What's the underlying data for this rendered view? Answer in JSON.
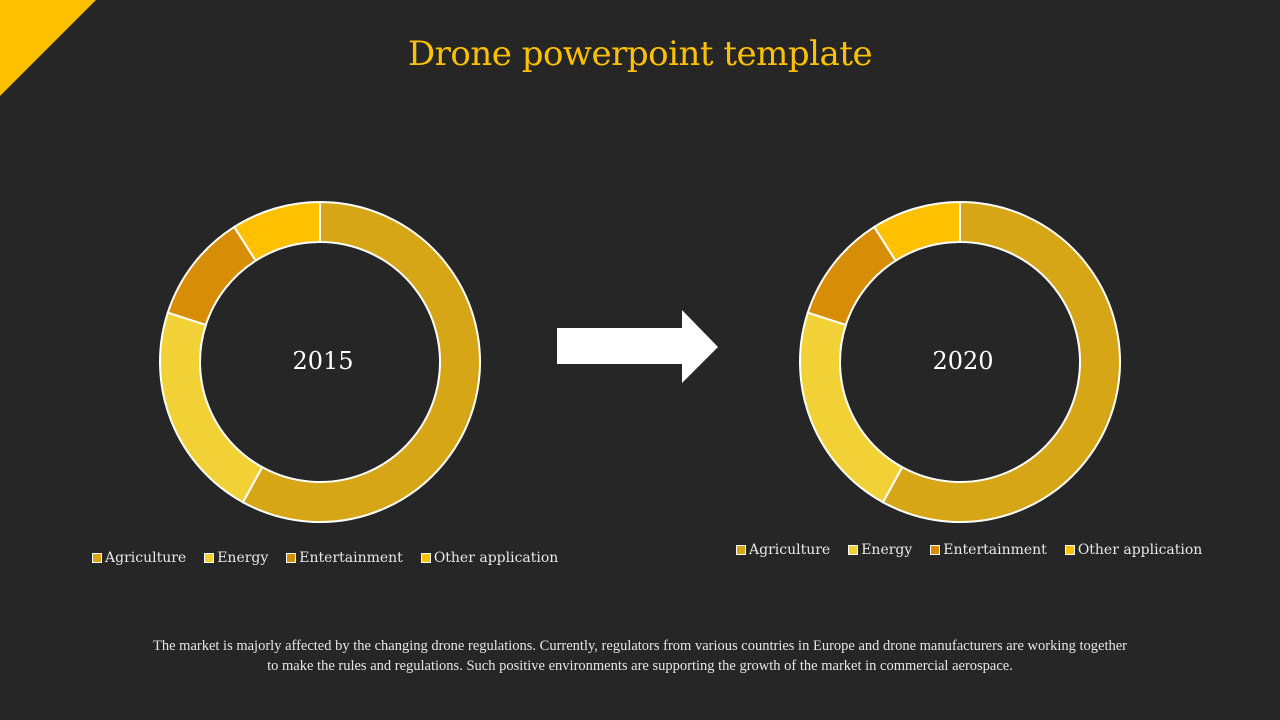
{
  "slide": {
    "title": "Drone powerpoint template",
    "accent_color": "#FFC000",
    "background_color": "#262626",
    "body_text": "The market is majorly affected by the changing drone regulations. Currently, regulators from various countries in Europe and drone manufacturers are working together to make the rules and regulations. Such positive environments are supporting the growth of the market in commercial aerospace.",
    "arrow_icon": "right-arrow"
  },
  "chart_data": [
    {
      "type": "pie",
      "variant": "donut",
      "title": "2015",
      "categories": [
        "Agriculture",
        "Energy",
        "Entertainment",
        "Other application"
      ],
      "values": [
        58,
        22,
        11,
        9
      ],
      "colors": [
        "#D6A617",
        "#F2D136",
        "#D78E06",
        "#FFC000"
      ],
      "legend_position": "bottom"
    },
    {
      "type": "pie",
      "variant": "donut",
      "title": "2020",
      "categories": [
        "Agriculture",
        "Energy",
        "Entertainment",
        "Other application"
      ],
      "values": [
        58,
        22,
        11,
        9
      ],
      "colors": [
        "#D6A617",
        "#F2D136",
        "#D78E06",
        "#FFC000"
      ],
      "legend_position": "bottom"
    }
  ]
}
